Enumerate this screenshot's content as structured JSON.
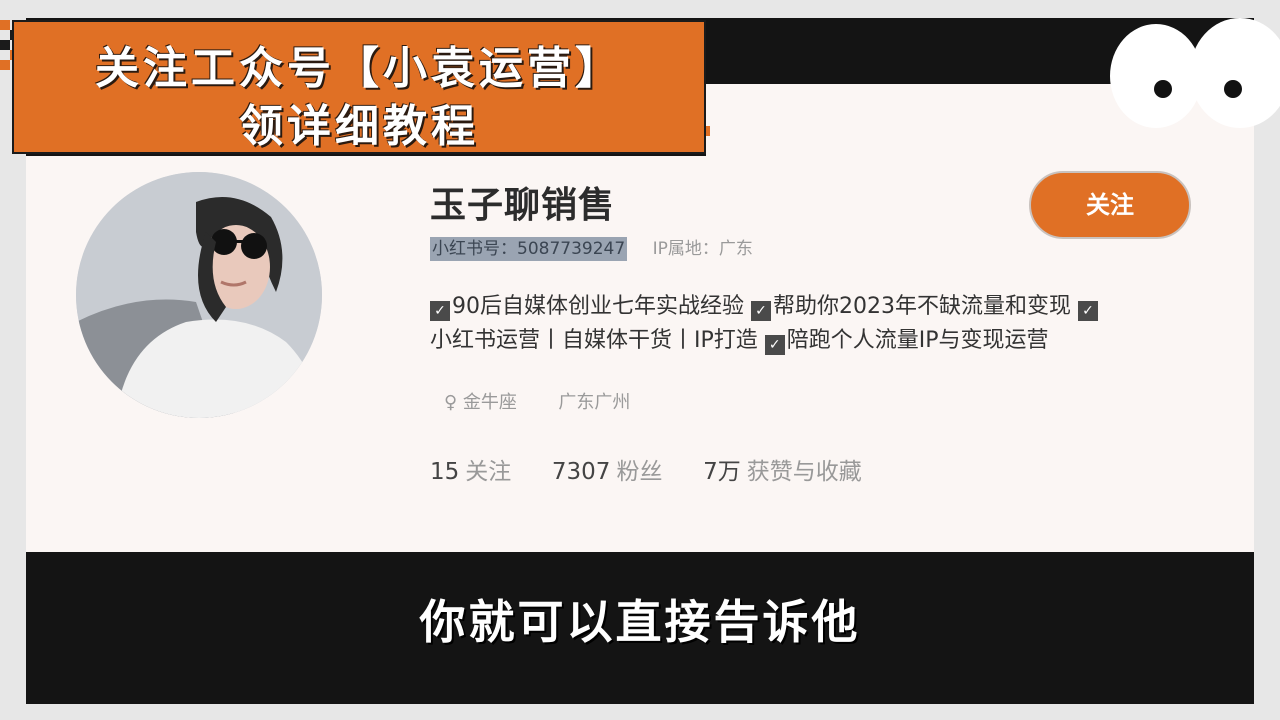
{
  "banner": {
    "line1": "关注工众号【小袁运营】",
    "line2": "领详细教程",
    "color": "#e07025"
  },
  "profile": {
    "name": "玉子聊销售",
    "id_text": "小红书号：5087739247",
    "ip_text": "IP属地：广东",
    "follow_label": "关注",
    "bio": {
      "line1": [
        "90后自媒体创业七年实战经验",
        "帮助你2023年不缺流量和变现"
      ],
      "line2_prefix": "小红书运营丨自媒体干货丨IP打造",
      "line2_suffix": "陪跑个人流量IP与变现运营"
    },
    "tags": {
      "gender_icon": "female-icon",
      "zodiac": "金牛座",
      "location": "广东广州"
    },
    "stats": {
      "following_count": "15",
      "following_label": "关注",
      "followers_count": "7307",
      "followers_label": "粉丝",
      "likes_count": "7万",
      "likes_label": "获赞与收藏"
    }
  },
  "subtitle": "你就可以直接告诉他"
}
